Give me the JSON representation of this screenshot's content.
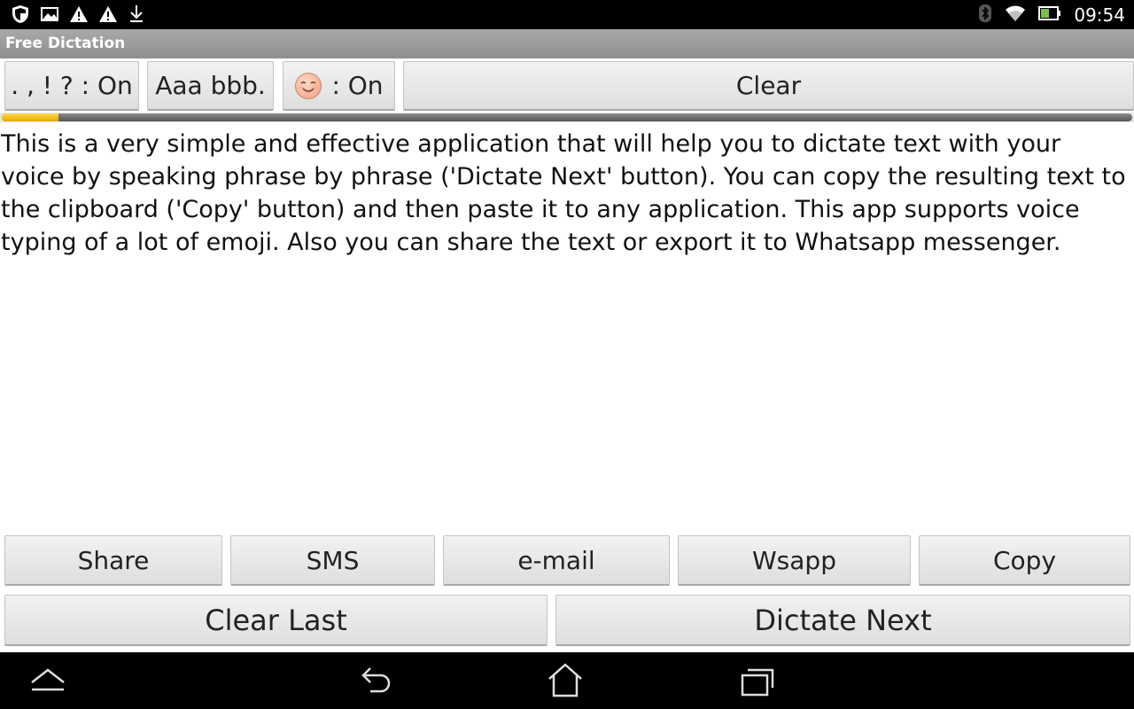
{
  "status_bar": {
    "time": "09:54",
    "left_icons": [
      "shield-icon",
      "image-icon",
      "warning-icon",
      "warning-icon",
      "download-icon"
    ],
    "right_icons": [
      "bluetooth-icon",
      "wifi-icon",
      "battery-icon"
    ]
  },
  "app": {
    "title": "Free Dictation"
  },
  "toolbar": {
    "punctuation_label": ". , ! ? : On",
    "case_label": "Aaa bbb.",
    "emoji_label": ": On",
    "clear_label": "Clear"
  },
  "progress": {
    "value_percent": 5
  },
  "main": {
    "text": "This is a very simple and effective application that will help you to dictate text with your voice by speaking phrase by phrase ('Dictate Next' button). You can copy the resulting text to the clipboard ('Copy' button) and then paste it to any application. This app supports voice typing of a lot of emoji. Also you can share the text or export it to Whatsapp messenger."
  },
  "actions": {
    "share_label": "Share",
    "sms_label": "SMS",
    "email_label": "e-mail",
    "wsapp_label": "Wsapp",
    "copy_label": "Copy",
    "clear_last_label": "Clear Last",
    "dictate_next_label": "Dictate Next"
  },
  "nav_bar": {
    "icons": [
      "hide-keyboard-icon",
      "back-icon",
      "home-icon",
      "recent-apps-icon"
    ]
  },
  "colors": {
    "progress_fill": "#f2c200",
    "title_bar": "#9a9a9a"
  }
}
